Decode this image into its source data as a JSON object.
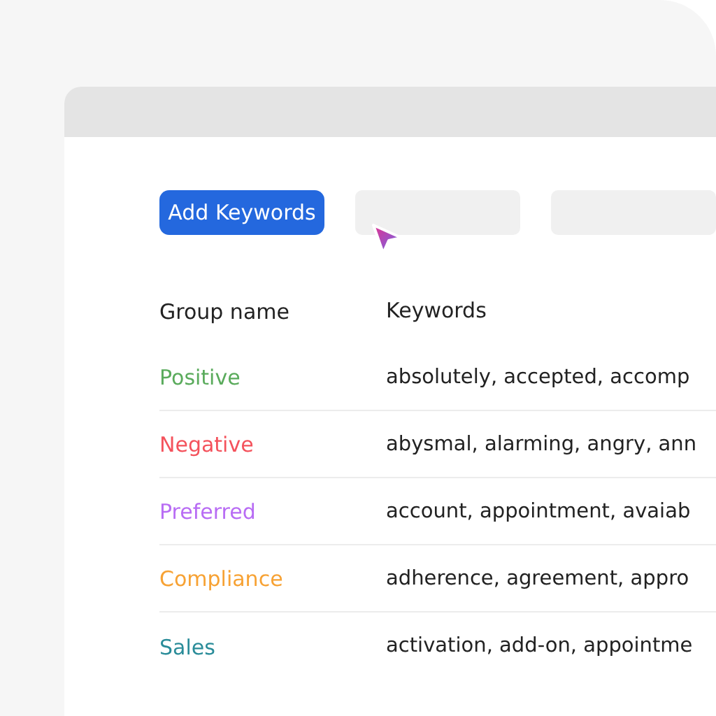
{
  "toolbar": {
    "add_button": "Add Keywords"
  },
  "table": {
    "columns": [
      "Group name",
      "Keywords"
    ],
    "rows": [
      {
        "group": "Positive",
        "color": "#5aab5c",
        "keywords": "absolutely, accepted, accomp"
      },
      {
        "group": "Negative",
        "color": "#f4525c",
        "keywords": "abysmal, alarming, angry, ann"
      },
      {
        "group": "Preferred",
        "color": "#b86cf4",
        "keywords": "account, appointment, avaiab"
      },
      {
        "group": "Compliance",
        "color": "#f7a234",
        "keywords": "adherence, agreement, appro"
      },
      {
        "group": "Sales",
        "color": "#2a8c99",
        "keywords": "activation, add-on, appointme"
      }
    ]
  }
}
